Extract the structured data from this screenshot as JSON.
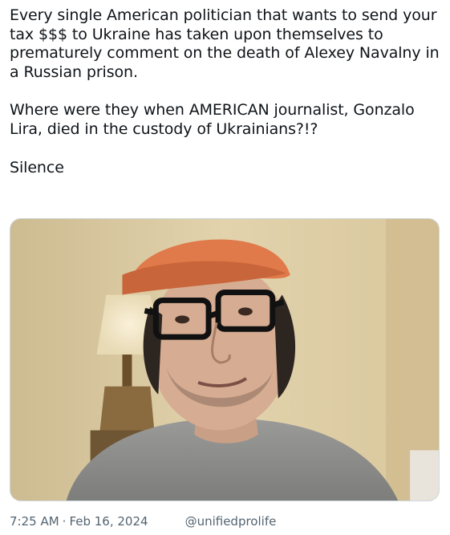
{
  "tweet": {
    "paragraphs": [
      "Every single American politician that wants to send your tax $$$ to Ukraine has taken upon themselves to prematurely comment on the death of Alexey Navalny in a Russian prison.",
      "Where were they when AMERICAN journalist, Gonzalo Lira, died in the custody of Ukrainians?!?",
      "Silence"
    ],
    "media": {
      "description_icon": "video-still-image"
    },
    "time": "7:25 AM",
    "separator": "·",
    "date": "Feb 16, 2024",
    "handle": "@unifiedprolife"
  }
}
